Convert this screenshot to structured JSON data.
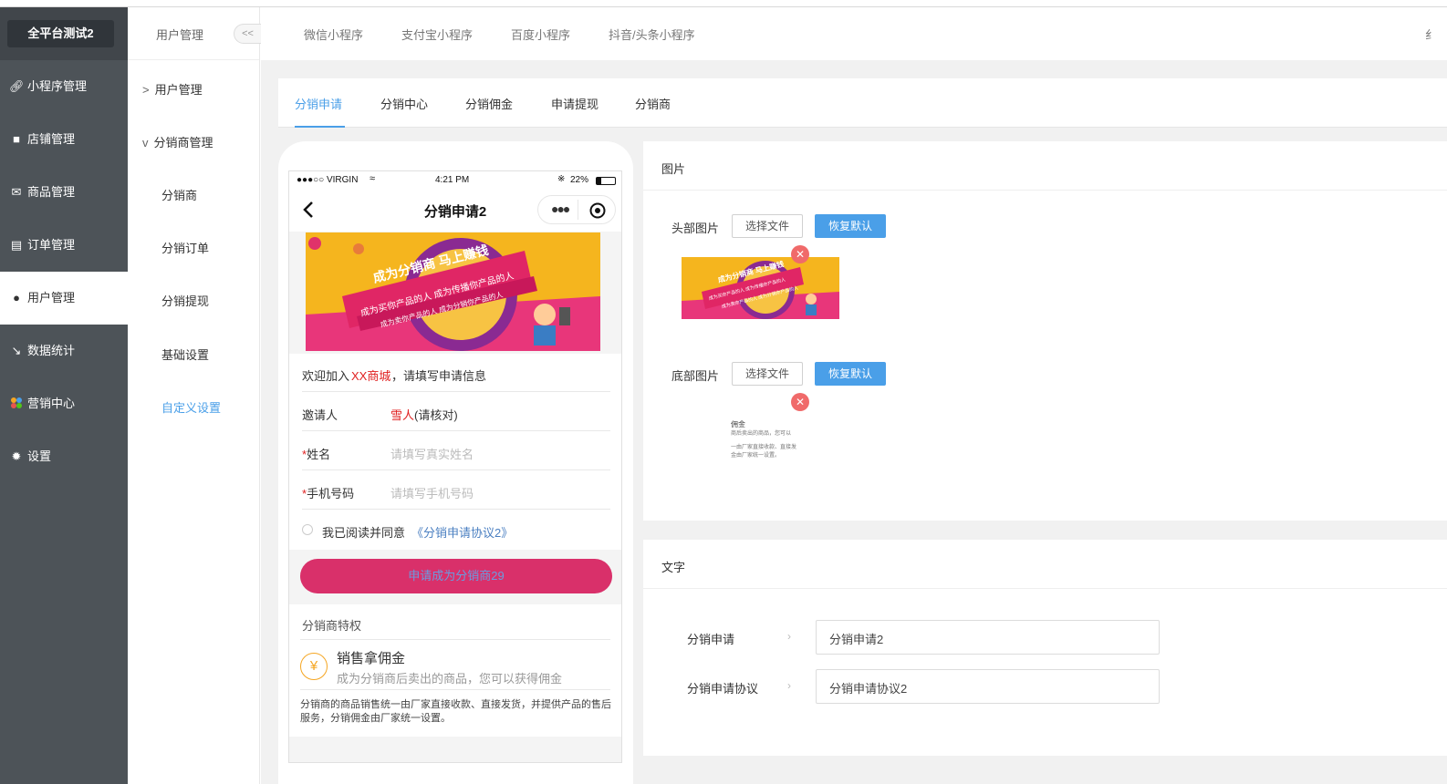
{
  "app": {
    "brand": "全平台测试2"
  },
  "sidebar": {
    "items": [
      {
        "label": "小程序管理",
        "icon": "link-icon"
      },
      {
        "label": "店铺管理",
        "icon": "store-icon"
      },
      {
        "label": "商品管理",
        "icon": "goods-icon"
      },
      {
        "label": "订单管理",
        "icon": "order-icon"
      },
      {
        "label": "用户管理",
        "icon": "user-icon"
      },
      {
        "label": "数据统计",
        "icon": "chart-icon"
      },
      {
        "label": "营销中心",
        "icon": "marketing-icon"
      },
      {
        "label": "设置",
        "icon": "settings-icon"
      }
    ]
  },
  "subnav": {
    "title": "用户管理",
    "collapse": "<<",
    "groups": [
      {
        "label": "用户管理",
        "chevron": ">"
      },
      {
        "label": "分销商管理",
        "chevron": "v"
      }
    ],
    "items": [
      "分销商",
      "分销订单",
      "分销提现",
      "基础设置",
      "自定义设置"
    ]
  },
  "topnav": {
    "items": [
      "微信小程序",
      "支付宝小程序",
      "百度小程序",
      "抖音/头条小程序"
    ],
    "partial": "纟"
  },
  "tabs": [
    "分销申请",
    "分销中心",
    "分销佣金",
    "申请提现",
    "分销商"
  ],
  "phone": {
    "status": {
      "carrier": "●●●○○ VIRGIN",
      "time": "4:21 PM",
      "battery": "22%"
    },
    "title": "分销申请2",
    "banner": {
      "headline": "成为分销商 马上赚钱",
      "line1": "成为买你产品的人 成为传播你产品的人",
      "line2": "成为卖你产品的人 成为分销你产品的人"
    },
    "welcome": {
      "prefix": "欢迎加入",
      "shop": "XX商城",
      "suffix": "，请填写申请信息"
    },
    "inviter": {
      "label": "邀请人",
      "name": "雪人",
      "note": "(请核对)"
    },
    "name_field": {
      "label": "姓名",
      "placeholder": "请填写真实姓名"
    },
    "phone_field": {
      "label": "手机号码",
      "placeholder": "请填写手机号码"
    },
    "agree": {
      "text": "我已阅读并同意",
      "link": "《分销申请协议2》"
    },
    "apply_button": "申请成为分销商29",
    "privilege": {
      "title": "分销商特权",
      "item_title": "销售拿佣金",
      "item_desc": "成为分销商后卖出的商品，您可以获得佣金",
      "note": "分销商的商品销售统一由厂家直接收款、直接发货，并提供产品的售后服务，分销佣金由厂家统一设置。"
    }
  },
  "images_panel": {
    "title": "图片",
    "header_label": "头部图片",
    "footer_label": "底部图片",
    "choose_file": "选择文件",
    "reset": "恢复默认",
    "thumb_banner": {
      "headline": "成为分销商 马上赚钱",
      "line1": "成为买你产品的人 成为传播你产品的人",
      "line2": "成为卖你产品的人 成为分销你产品的人"
    },
    "footer_thumb": {
      "line1": "佣金",
      "line2": "商后卖出的商品，您可以",
      "line3": "一由厂家直接收款、直接发",
      "line4": "金由厂家统一设置。"
    }
  },
  "text_panel": {
    "title": "文字",
    "fields": [
      {
        "label": "分销申请",
        "value": "分销申请2"
      },
      {
        "label": "分销申请协议",
        "value": "分销申请协议2"
      }
    ]
  },
  "colors": {
    "accent": "#4a9fe8",
    "sidebar": "#4d5358",
    "apply_button": "#d9306a",
    "banner": "#f5b51e"
  }
}
